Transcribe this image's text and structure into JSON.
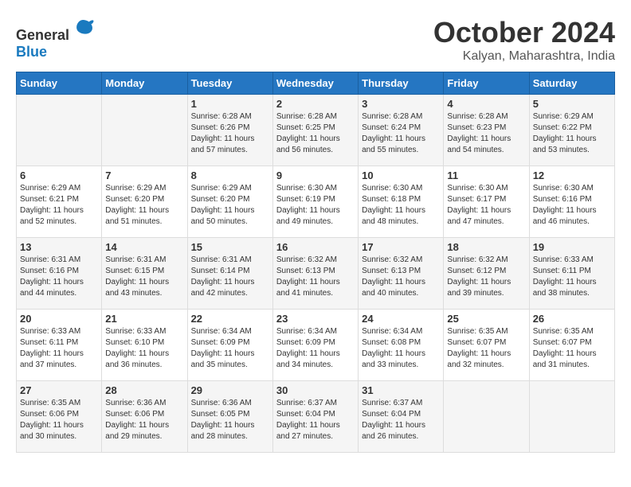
{
  "header": {
    "logo_general": "General",
    "logo_blue": "Blue",
    "month": "October 2024",
    "location": "Kalyan, Maharashtra, India"
  },
  "days_of_week": [
    "Sunday",
    "Monday",
    "Tuesday",
    "Wednesday",
    "Thursday",
    "Friday",
    "Saturday"
  ],
  "weeks": [
    [
      {
        "day": "",
        "info": ""
      },
      {
        "day": "",
        "info": ""
      },
      {
        "day": "1",
        "sunrise": "6:28 AM",
        "sunset": "6:26 PM",
        "daylight": "11 hours and 57 minutes."
      },
      {
        "day": "2",
        "sunrise": "6:28 AM",
        "sunset": "6:25 PM",
        "daylight": "11 hours and 56 minutes."
      },
      {
        "day": "3",
        "sunrise": "6:28 AM",
        "sunset": "6:24 PM",
        "daylight": "11 hours and 55 minutes."
      },
      {
        "day": "4",
        "sunrise": "6:28 AM",
        "sunset": "6:23 PM",
        "daylight": "11 hours and 54 minutes."
      },
      {
        "day": "5",
        "sunrise": "6:29 AM",
        "sunset": "6:22 PM",
        "daylight": "11 hours and 53 minutes."
      }
    ],
    [
      {
        "day": "6",
        "sunrise": "6:29 AM",
        "sunset": "6:21 PM",
        "daylight": "11 hours and 52 minutes."
      },
      {
        "day": "7",
        "sunrise": "6:29 AM",
        "sunset": "6:20 PM",
        "daylight": "11 hours and 51 minutes."
      },
      {
        "day": "8",
        "sunrise": "6:29 AM",
        "sunset": "6:20 PM",
        "daylight": "11 hours and 50 minutes."
      },
      {
        "day": "9",
        "sunrise": "6:30 AM",
        "sunset": "6:19 PM",
        "daylight": "11 hours and 49 minutes."
      },
      {
        "day": "10",
        "sunrise": "6:30 AM",
        "sunset": "6:18 PM",
        "daylight": "11 hours and 48 minutes."
      },
      {
        "day": "11",
        "sunrise": "6:30 AM",
        "sunset": "6:17 PM",
        "daylight": "11 hours and 47 minutes."
      },
      {
        "day": "12",
        "sunrise": "6:30 AM",
        "sunset": "6:16 PM",
        "daylight": "11 hours and 46 minutes."
      }
    ],
    [
      {
        "day": "13",
        "sunrise": "6:31 AM",
        "sunset": "6:16 PM",
        "daylight": "11 hours and 44 minutes."
      },
      {
        "day": "14",
        "sunrise": "6:31 AM",
        "sunset": "6:15 PM",
        "daylight": "11 hours and 43 minutes."
      },
      {
        "day": "15",
        "sunrise": "6:31 AM",
        "sunset": "6:14 PM",
        "daylight": "11 hours and 42 minutes."
      },
      {
        "day": "16",
        "sunrise": "6:32 AM",
        "sunset": "6:13 PM",
        "daylight": "11 hours and 41 minutes."
      },
      {
        "day": "17",
        "sunrise": "6:32 AM",
        "sunset": "6:13 PM",
        "daylight": "11 hours and 40 minutes."
      },
      {
        "day": "18",
        "sunrise": "6:32 AM",
        "sunset": "6:12 PM",
        "daylight": "11 hours and 39 minutes."
      },
      {
        "day": "19",
        "sunrise": "6:33 AM",
        "sunset": "6:11 PM",
        "daylight": "11 hours and 38 minutes."
      }
    ],
    [
      {
        "day": "20",
        "sunrise": "6:33 AM",
        "sunset": "6:11 PM",
        "daylight": "11 hours and 37 minutes."
      },
      {
        "day": "21",
        "sunrise": "6:33 AM",
        "sunset": "6:10 PM",
        "daylight": "11 hours and 36 minutes."
      },
      {
        "day": "22",
        "sunrise": "6:34 AM",
        "sunset": "6:09 PM",
        "daylight": "11 hours and 35 minutes."
      },
      {
        "day": "23",
        "sunrise": "6:34 AM",
        "sunset": "6:09 PM",
        "daylight": "11 hours and 34 minutes."
      },
      {
        "day": "24",
        "sunrise": "6:34 AM",
        "sunset": "6:08 PM",
        "daylight": "11 hours and 33 minutes."
      },
      {
        "day": "25",
        "sunrise": "6:35 AM",
        "sunset": "6:07 PM",
        "daylight": "11 hours and 32 minutes."
      },
      {
        "day": "26",
        "sunrise": "6:35 AM",
        "sunset": "6:07 PM",
        "daylight": "11 hours and 31 minutes."
      }
    ],
    [
      {
        "day": "27",
        "sunrise": "6:35 AM",
        "sunset": "6:06 PM",
        "daylight": "11 hours and 30 minutes."
      },
      {
        "day": "28",
        "sunrise": "6:36 AM",
        "sunset": "6:06 PM",
        "daylight": "11 hours and 29 minutes."
      },
      {
        "day": "29",
        "sunrise": "6:36 AM",
        "sunset": "6:05 PM",
        "daylight": "11 hours and 28 minutes."
      },
      {
        "day": "30",
        "sunrise": "6:37 AM",
        "sunset": "6:04 PM",
        "daylight": "11 hours and 27 minutes."
      },
      {
        "day": "31",
        "sunrise": "6:37 AM",
        "sunset": "6:04 PM",
        "daylight": "11 hours and 26 minutes."
      },
      {
        "day": "",
        "info": ""
      },
      {
        "day": "",
        "info": ""
      }
    ]
  ],
  "labels": {
    "sunrise": "Sunrise:",
    "sunset": "Sunset:",
    "daylight": "Daylight:"
  }
}
